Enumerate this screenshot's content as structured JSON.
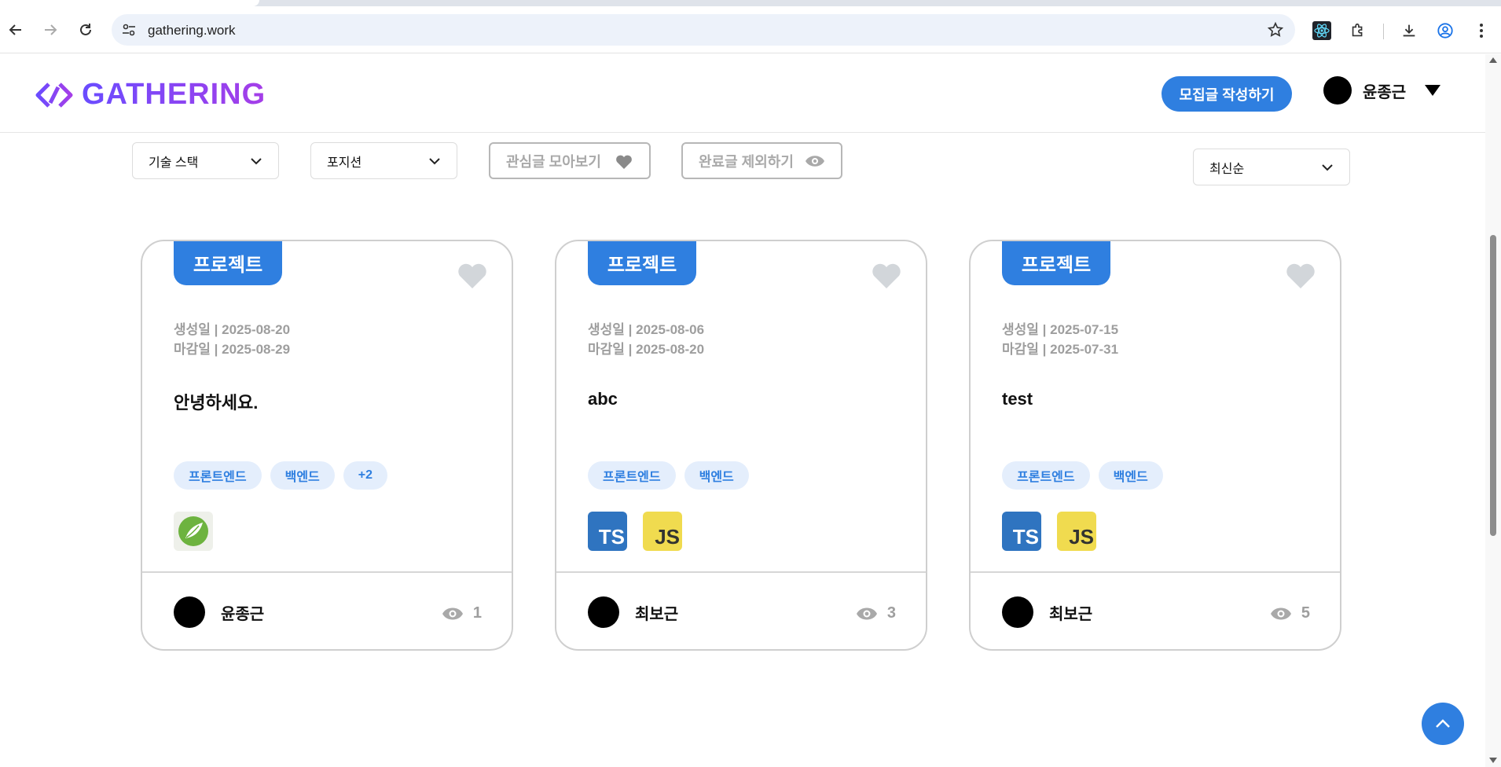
{
  "browser": {
    "url": "gathering.work"
  },
  "header": {
    "logo_text": "GATHERING",
    "write_button": "모집글 작성하기",
    "user_name": "윤종근"
  },
  "filters": {
    "tech_stack": "기술 스택",
    "position": "포지션",
    "favorites": "관심글 모아보기",
    "exclude_done": "완료글 제외하기",
    "sort": "최신순"
  },
  "cards": [
    {
      "badge": "프로젝트",
      "created": "생성일 | 2025-08-20",
      "deadline": "마감일 | 2025-08-29",
      "title": "안녕하세요.",
      "tags": [
        "프론트엔드",
        "백엔드",
        "+2"
      ],
      "stacks": [
        "spring-icon"
      ],
      "author": "윤종근",
      "views": "1"
    },
    {
      "badge": "프로젝트",
      "created": "생성일 | 2025-08-06",
      "deadline": "마감일 | 2025-08-20",
      "title": "abc",
      "tags": [
        "프론트엔드",
        "백엔드"
      ],
      "stacks": [
        "TS",
        "JS"
      ],
      "author": "최보근",
      "views": "3"
    },
    {
      "badge": "프로젝트",
      "created": "생성일 | 2025-07-15",
      "deadline": "마감일 | 2025-07-31",
      "title": "test",
      "tags": [
        "프론트엔드",
        "백엔드"
      ],
      "stacks": [
        "TS",
        "JS"
      ],
      "author": "최보근",
      "views": "5"
    }
  ],
  "colors": {
    "primary": "#2f7fe0",
    "tag_bg": "#e4eefc",
    "muted": "#9e9e9e",
    "logo_gradient": [
      "#6a4cff",
      "#a53ee8"
    ]
  }
}
